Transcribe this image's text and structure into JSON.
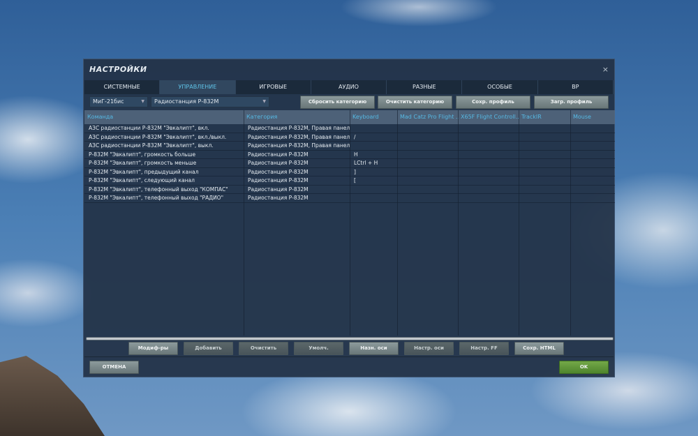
{
  "title": "НАСТРОЙКИ",
  "tabs": [
    {
      "label": "СИСТЕМНЫЕ"
    },
    {
      "label": "УПРАВЛЕНИЕ",
      "active": true
    },
    {
      "label": "ИГРОВЫЕ"
    },
    {
      "label": "АУДИО"
    },
    {
      "label": "РАЗНЫЕ"
    },
    {
      "label": "ОСОБЫЕ"
    },
    {
      "label": "ВР"
    }
  ],
  "toolbar": {
    "aircraft": "МиГ-21бис",
    "category": "Радиостанция Р-832М",
    "reset_category": "Сбросить категорию",
    "clear_category": "Очистить категорию",
    "save_profile": "Сохр. профиль",
    "load_profile": "Загр. профиль"
  },
  "table": {
    "columns": [
      "Команда",
      "Категория",
      "Keyboard",
      "Mad Catz Pro Flight ...",
      "X65F Flight Controll...",
      "TrackIR",
      "Mouse"
    ],
    "rows": [
      [
        "АЗС радиостанции Р-832М \"Эвкалипт\", вкл.",
        "Радиостанция Р-832М, Правая панель",
        ""
      ],
      [
        "АЗС радиостанции Р-832М \"Эвкалипт\", вкл./выкл.",
        "Радиостанция Р-832М, Правая панель",
        "/"
      ],
      [
        "АЗС радиостанции Р-832М \"Эвкалипт\", выкл.",
        "Радиостанция Р-832М, Правая панель",
        ""
      ],
      [
        "Р-832М \"Эвкалипт\", громкость больше",
        "Радиостанция Р-832М",
        "H"
      ],
      [
        "Р-832М \"Эвкалипт\", громкость меньше",
        "Радиостанция Р-832М",
        "LCtrl + H"
      ],
      [
        "Р-832М \"Эвкалипт\", предыдущий канал",
        "Радиостанция Р-832М",
        "]"
      ],
      [
        "Р-832М \"Эвкалипт\", следующий канал",
        "Радиостанция Р-832М",
        "["
      ],
      [
        "Р-832М \"Эвкалипт\", телефонный выход \"КОМПАС\"",
        "Радиостанция Р-832М",
        ""
      ],
      [
        "Р-832М \"Эвкалипт\", телефонный выход \"РАДИО\"",
        "Радиостанция Р-832М",
        ""
      ]
    ]
  },
  "bottom_buttons": [
    "Модиф-ры",
    "Добавить",
    "Очистить",
    "Умолч.",
    "Назн. оси",
    "Настр. оси",
    "Настр. FF",
    "Сохр. HTML"
  ],
  "cancel": "ОТМЕНА",
  "ok": "OK",
  "close_icon": "×",
  "colors": {
    "accent": "#56b9e4",
    "ok": "#5f9a38"
  }
}
